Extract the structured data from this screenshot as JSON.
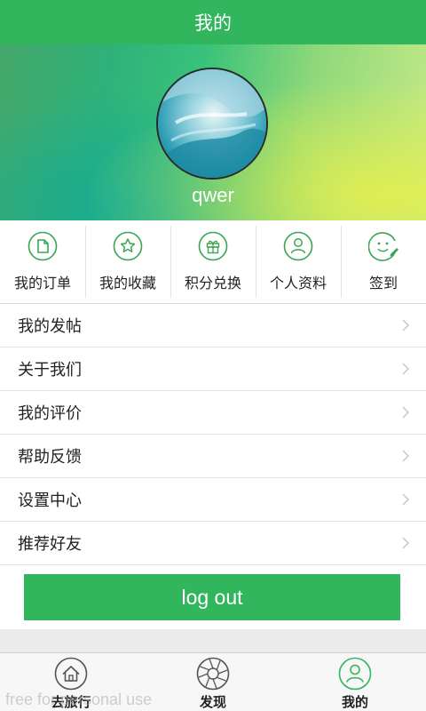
{
  "header": {
    "title": "我的"
  },
  "profile": {
    "username": "qwer"
  },
  "shortcuts": [
    {
      "label": "我的订单",
      "icon": "order-icon"
    },
    {
      "label": "我的收藏",
      "icon": "star-icon"
    },
    {
      "label": "积分兑换",
      "icon": "gift-icon"
    },
    {
      "label": "个人资料",
      "icon": "person-icon"
    },
    {
      "label": "签到",
      "icon": "smile-edit-icon"
    }
  ],
  "menu": [
    {
      "label": "我的发帖"
    },
    {
      "label": "关于我们"
    },
    {
      "label": "我的评价"
    },
    {
      "label": "帮助反馈"
    },
    {
      "label": "设置中心"
    },
    {
      "label": "推荐好友"
    }
  ],
  "logout": {
    "label": "log out"
  },
  "tabs": [
    {
      "label": "去旅行",
      "icon": "home-icon"
    },
    {
      "label": "发现",
      "icon": "aperture-icon"
    },
    {
      "label": "我的",
      "icon": "person-icon",
      "active": true
    }
  ],
  "watermark": "free for personal use",
  "colors": {
    "accent": "#31b65d",
    "icon_green": "#3aa655"
  }
}
